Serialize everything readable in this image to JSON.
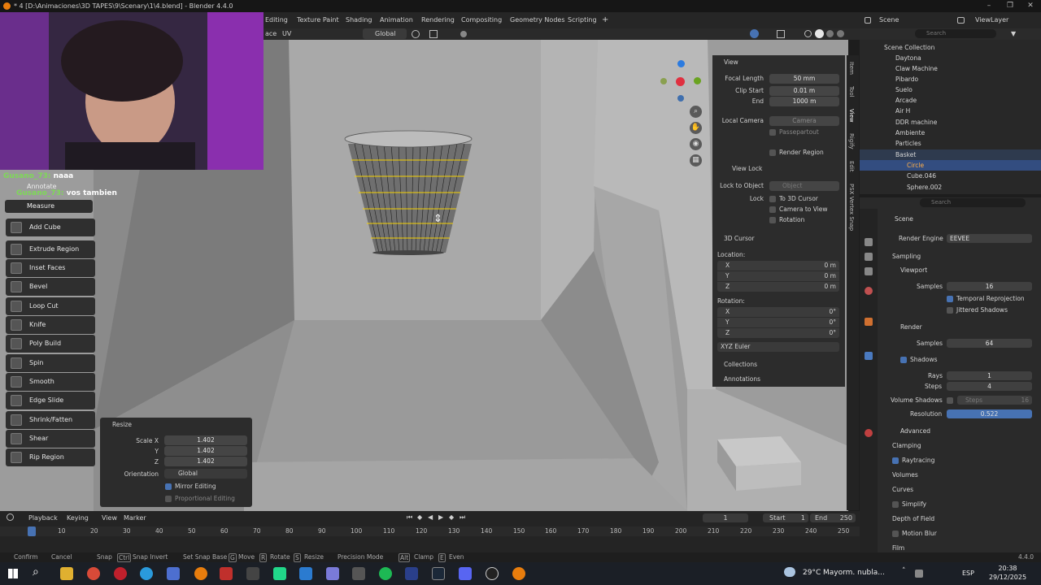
{
  "window": {
    "title": "* 4 [D:\\Animaciones\\3D TAPES\\9\\Scenary\\1\\4.blend] - Blender 4.4.0"
  },
  "menubar": {
    "tabs": [
      "Editing",
      "Texture Paint",
      "Shading",
      "Animation",
      "Rendering",
      "Compositing",
      "Geometry Nodes",
      "Scripting"
    ],
    "add_tab": "+",
    "scene": "Scene",
    "view_layer": "ViewLayer"
  },
  "header3d": {
    "face": "ace",
    "uv": "UV",
    "orientation": "Global"
  },
  "chat": [
    {
      "user": "Gusano_73:",
      "text": "naaa"
    },
    {
      "user": "Gusano_73:",
      "text": "vos tambien"
    }
  ],
  "tools": {
    "annotate": "Annotate",
    "measure": "Measure",
    "items": [
      "Add Cube",
      "Extrude Region",
      "Inset Faces",
      "Bevel",
      "Loop Cut",
      "Knife",
      "Poly Build",
      "Spin",
      "Smooth",
      "Edge Slide",
      "Shrink/Fatten",
      "Shear",
      "Rip Region"
    ]
  },
  "npanel": {
    "view_header": "View",
    "focal_length_label": "Focal Length",
    "focal_length": "50 mm",
    "clip_start_label": "Clip Start",
    "clip_start": "0.01 m",
    "end_label": "End",
    "end": "1000 m",
    "local_camera_label": "Local Camera",
    "camera": "Camera",
    "passepartout": "Passepartout",
    "render_region": "Render Region",
    "view_lock_header": "View Lock",
    "lock_to_object_label": "Lock to Object",
    "object_placeholder": "Object",
    "lock_label": "Lock",
    "to_3d_cursor": "To 3D Cursor",
    "camera_to_view": "Camera to View",
    "rotation_lock": "Rotation",
    "cursor_header": "3D Cursor",
    "location_label": "Location:",
    "loc": [
      {
        "axis": "X",
        "value": "0 m"
      },
      {
        "axis": "Y",
        "value": "0 m"
      },
      {
        "axis": "Z",
        "value": "0 m"
      }
    ],
    "rotation_label": "Rotation:",
    "rot": [
      {
        "axis": "X",
        "value": "0°"
      },
      {
        "axis": "Y",
        "value": "0°"
      },
      {
        "axis": "Z",
        "value": "0°"
      }
    ],
    "rotation_mode": "XYZ Euler",
    "collections": "Collections",
    "annotations": "Annotations"
  },
  "sidetabs": [
    "Item",
    "Tool",
    "View",
    "Rigify",
    "Edit",
    "PSX Vertex Snap"
  ],
  "outliner": {
    "search_placeholder": "Search",
    "root": "Scene Collection",
    "items": [
      "Daytona",
      "Claw Machine",
      "Pibardo",
      "Suelo",
      "Arcade",
      "Air H",
      "DDR machine",
      "Ambiente",
      "Particles",
      "Basket",
      "Circle",
      "Cube.046",
      "Sphere.002"
    ]
  },
  "properties": {
    "search_placeholder": "Search",
    "scene": "Scene",
    "render_engine_label": "Render Engine",
    "render_engine": "EEVEE",
    "sampling": "Sampling",
    "viewport": "Viewport",
    "samples_label": "Samples",
    "viewport_samples": "16",
    "temporal_reprojection": "Temporal Reprojection",
    "jittered_shadows": "Jittered Shadows",
    "render": "Render",
    "render_samples": "64",
    "shadows": "Shadows",
    "rays_label": "Rays",
    "rays": "1",
    "steps_label": "Steps",
    "steps": "4",
    "volume_shadows": "Volume Shadows",
    "vol_steps_label": "Steps",
    "vol_steps": "16",
    "resolution_label": "Resolution",
    "resolution": "0.522",
    "advanced": "Advanced",
    "clamping": "Clamping",
    "raytracing": "Raytracing",
    "volumes": "Volumes",
    "curves": "Curves",
    "simplify": "Simplify",
    "depth_of_field": "Depth of Field",
    "motion_blur": "Motion Blur",
    "film": "Film"
  },
  "resize_panel": {
    "title": "Resize",
    "scale": [
      {
        "axis": "Scale X",
        "value": "1.402"
      },
      {
        "axis": "Y",
        "value": "1.402"
      },
      {
        "axis": "Z",
        "value": "1.402"
      }
    ],
    "orientation_label": "Orientation",
    "orientation": "Global",
    "mirror_editing": "Mirror Editing",
    "proportional_editing": "Proportional Editing"
  },
  "timeline": {
    "playback": "Playback",
    "keying": "Keying",
    "view": "View",
    "marker": "Marker",
    "current_frame": "1",
    "start_label": "Start",
    "start": "1",
    "end_label": "End",
    "end": "250",
    "ruler": [
      "1",
      "10",
      "20",
      "30",
      "40",
      "50",
      "60",
      "70",
      "80",
      "90",
      "100",
      "110",
      "120",
      "130",
      "140",
      "150",
      "160",
      "170",
      "180",
      "190",
      "200",
      "210",
      "220",
      "230",
      "240",
      "250"
    ]
  },
  "statusbar": {
    "items": [
      "Confirm",
      "Cancel",
      "Snap",
      "Snap Invert",
      "Set Snap Base",
      "Move",
      "Rotate",
      "Resize",
      "Precision Mode",
      "Clamp",
      "Even"
    ],
    "keys": [
      "Ctrl",
      "G",
      "R",
      "S",
      "Alt",
      "E"
    ],
    "version": "4.4.0"
  },
  "taskbar": {
    "weather_temp": "29°C",
    "weather_text": "Mayorm. nubla...",
    "lang": "ESP",
    "time": "20:38",
    "date": "29/12/2025"
  },
  "colors": {
    "accent": "#4772b3",
    "selection": "#334d80",
    "edge_yellow": "#f5d000"
  }
}
